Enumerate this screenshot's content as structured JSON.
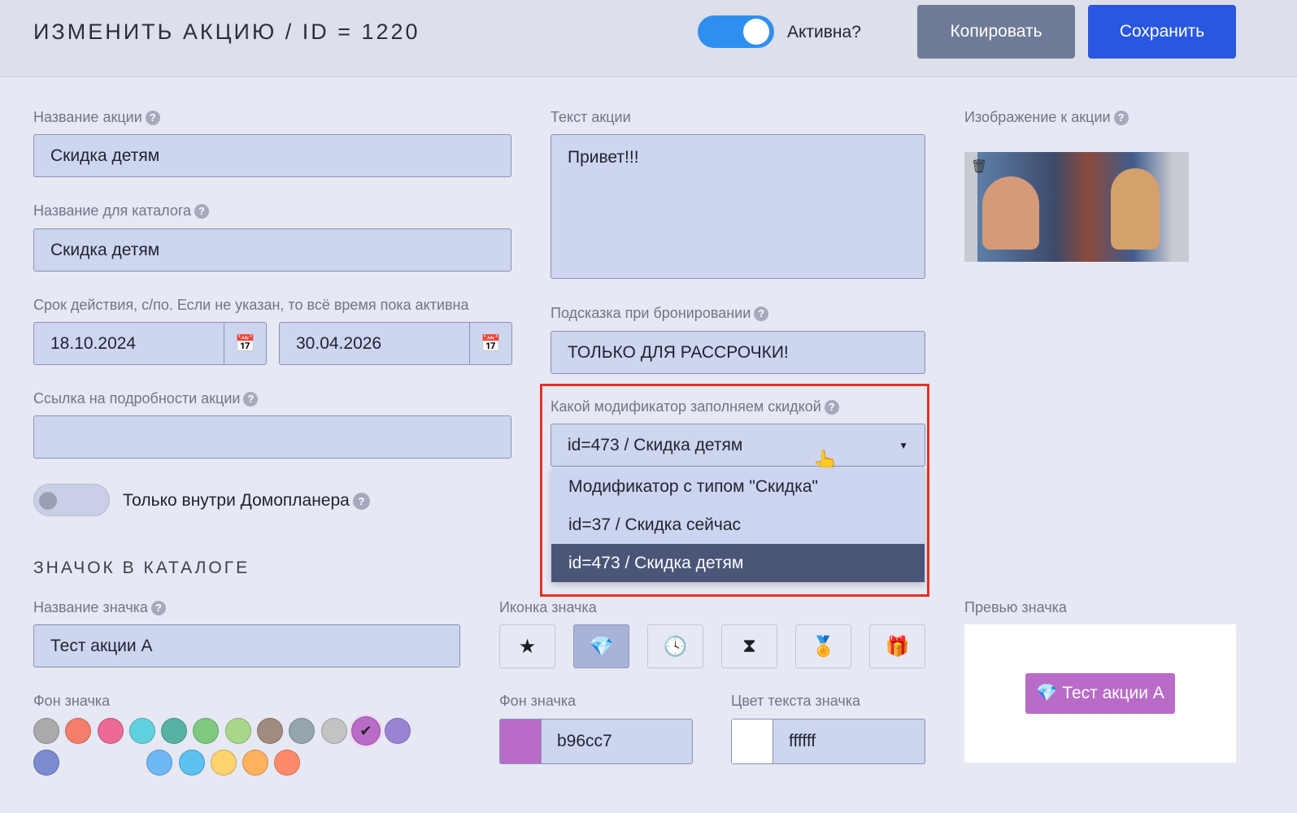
{
  "header": {
    "title": "ИЗМЕНИТЬ АКЦИЮ / ID = 1220",
    "active_label": "Активна?",
    "active": true,
    "copy_label": "Копировать",
    "save_label": "Сохранить"
  },
  "form": {
    "name_label": "Название акции",
    "name_value": "Скидка детям",
    "catalog_label": "Название для каталога",
    "catalog_value": "Скидка детям",
    "period_label": "Срок действия, с/по. Если не указан, то всё время пока активна",
    "date_from": "18.10.2024",
    "date_to": "30.04.2026",
    "link_label": "Ссылка на подробности акции",
    "link_value": "",
    "inside_label": "Только внутри Домопланера",
    "inside": false,
    "text_label": "Текст акции",
    "text_value": "Привет!!!",
    "hint_label": "Подсказка при бронировании",
    "hint_value": "ТОЛЬКО ДЛЯ РАССРОЧКИ!",
    "modifier_label": "Какой модификатор заполняем скидкой",
    "modifier_value": "id=473 / Скидка детям",
    "modifier_options": [
      "Модификатор с типом \"Скидка\"",
      "id=37 / Скидка сейчас",
      "id=473 / Скидка детям"
    ],
    "image_label": "Изображение к акции"
  },
  "badge": {
    "section_title": "ЗНАЧОК В КАТАЛОГЕ",
    "name_label": "Название значка",
    "name_value": "Тест акции А",
    "icon_label": "Иконка значка",
    "icons": [
      "star-icon",
      "diamond-icon",
      "clock-icon",
      "hourglass-icon",
      "award-icon",
      "gift-icon"
    ],
    "selected_icon": "diamond-icon",
    "bg_label": "Фон значка",
    "colors": [
      "#aaaaaa",
      "#f47d6c",
      "#ec6a95",
      "#5fd0de",
      "#56b3a3",
      "#7cc97f",
      "#aad68a",
      "#a18a80",
      "#93a6ae",
      "#c3c3c3",
      "#b96cc7",
      "#9b83d6",
      "#7b8bd0",
      "#6db8f5",
      "#5cc2f1",
      "#ffd36c",
      "#ffb25e",
      "#ff8a6b"
    ],
    "selected_color": "#b96cc7",
    "bg_color_label": "Фон значка",
    "bg_color_value": "b96cc7",
    "text_color_label": "Цвет текста значка",
    "text_color_value": "ffffff",
    "preview_label": "Превью значка",
    "preview_text": "Тест акции А"
  }
}
